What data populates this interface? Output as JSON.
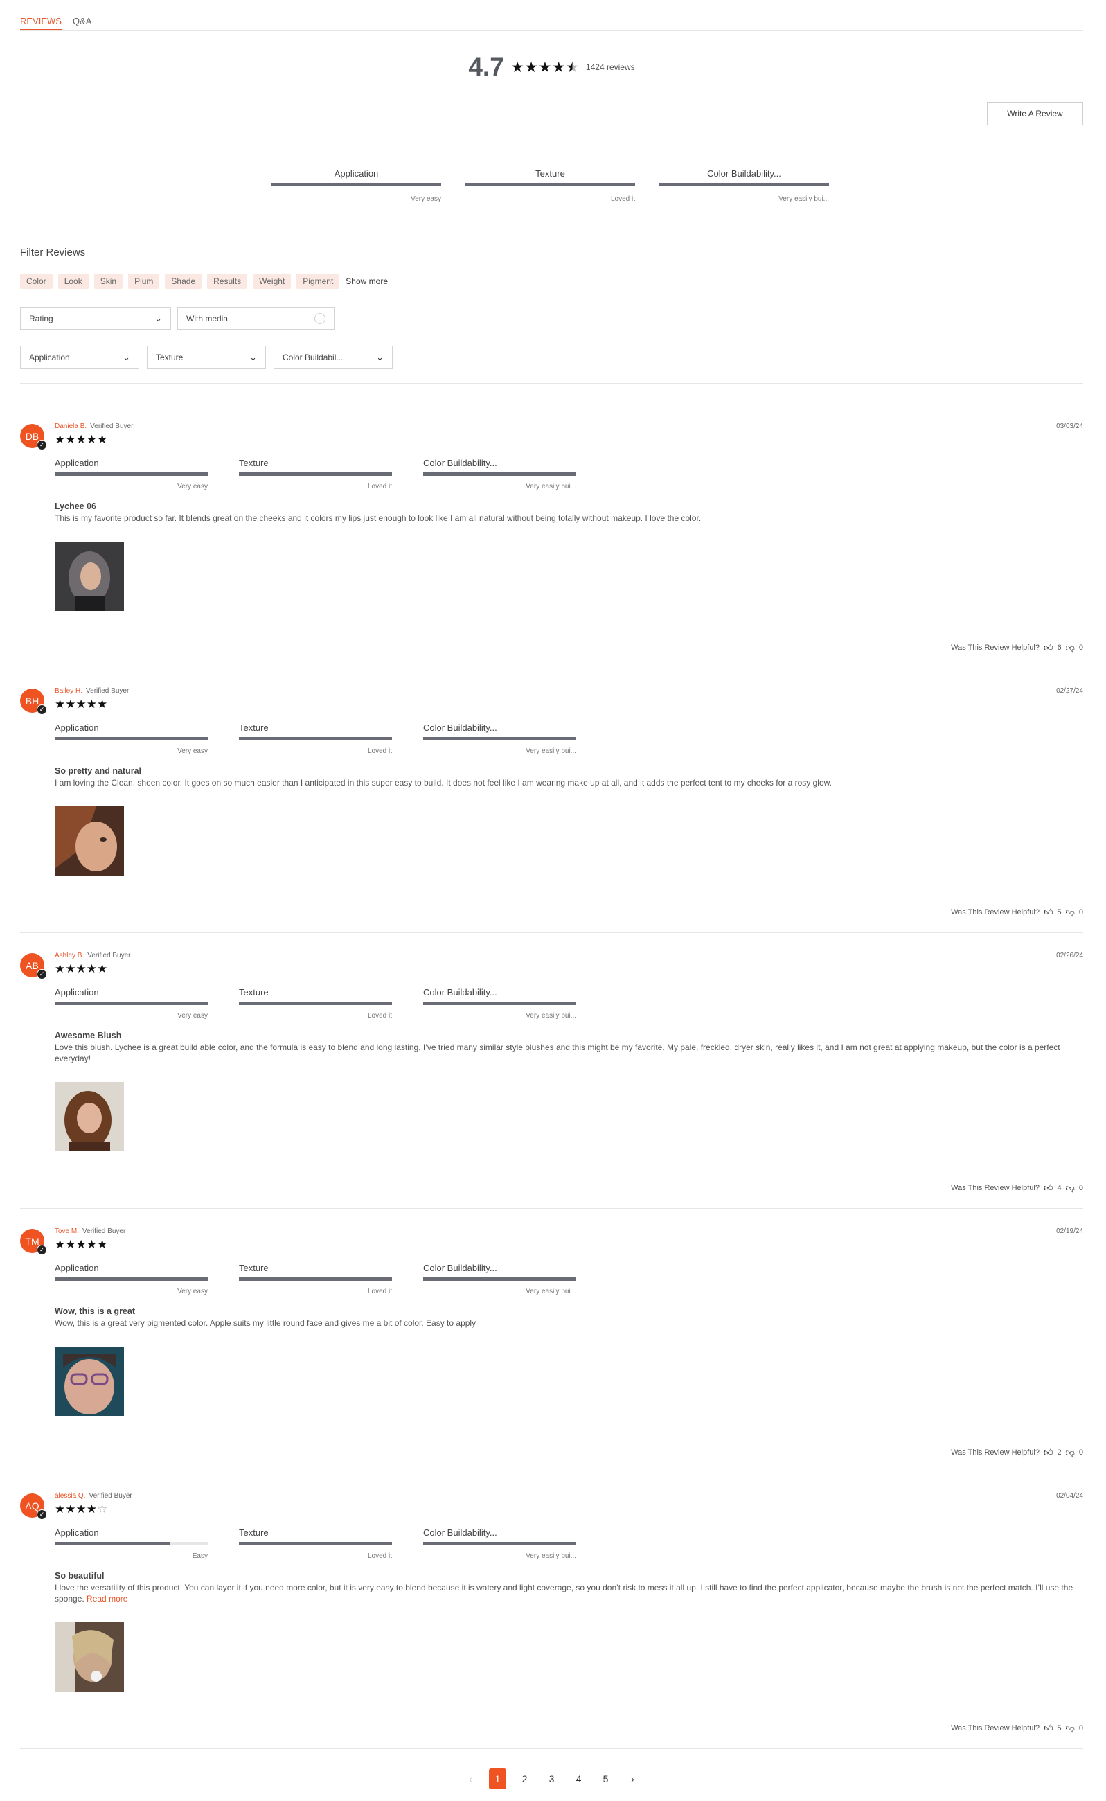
{
  "tabs": [
    {
      "label": "REVIEWS"
    },
    {
      "label": "Q&A"
    }
  ],
  "summary": {
    "rating": "4.7",
    "stars": 4.5,
    "count_text": "1424 reviews"
  },
  "write_review_label": "Write A Review",
  "attributes": [
    {
      "label": "Application",
      "value": "Very easy"
    },
    {
      "label": "Texture",
      "value": "Loved it"
    },
    {
      "label": "Color Buildability...",
      "value": "Very easily bui..."
    }
  ],
  "filters": {
    "title": "Filter Reviews",
    "chips": [
      "Color",
      "Look",
      "Skin",
      "Plum",
      "Shade",
      "Results",
      "Weight",
      "Pigment"
    ],
    "show_more": "Show more",
    "rating_select": "Rating",
    "media_toggle": "With media",
    "attr_selects": [
      "Application",
      "Texture",
      "Color Buildabil..."
    ]
  },
  "helpful_label": "Was This Review Helpful?",
  "verified_label": "Verified Buyer",
  "reviews": [
    {
      "initials": "DB",
      "name": "Daniela B.",
      "date": "03/03/24",
      "stars": 5,
      "attrs": [
        {
          "label": "Application",
          "value": "Very easy",
          "pct": 1
        },
        {
          "label": "Texture",
          "value": "Loved it",
          "pct": 1
        },
        {
          "label": "Color Buildability...",
          "value": "Very easily bui...",
          "pct": 1
        }
      ],
      "title": "Lychee 06",
      "body": "This is my favorite product so far. It blends great on the cheeks and it colors my lips just enough to look like I am all natural without being totally without makeup. I love the color.",
      "up": "6",
      "down": "0"
    },
    {
      "initials": "BH",
      "name": "Bailey H.",
      "date": "02/27/24",
      "stars": 5,
      "attrs": [
        {
          "label": "Application",
          "value": "Very easy",
          "pct": 1
        },
        {
          "label": "Texture",
          "value": "Loved it",
          "pct": 1
        },
        {
          "label": "Color Buildability...",
          "value": "Very easily bui...",
          "pct": 1
        }
      ],
      "title": "So pretty and natural",
      "body": "I am loving the Clean, sheen color. It goes on so much easier than I anticipated in this super easy to build. It does not feel like I am wearing make up at all, and it adds the perfect tent to my cheeks for a rosy glow.",
      "up": "5",
      "down": "0"
    },
    {
      "initials": "AB",
      "name": "Ashley B.",
      "date": "02/26/24",
      "stars": 5,
      "attrs": [
        {
          "label": "Application",
          "value": "Very easy",
          "pct": 1
        },
        {
          "label": "Texture",
          "value": "Loved it",
          "pct": 1
        },
        {
          "label": "Color Buildability...",
          "value": "Very easily bui...",
          "pct": 1
        }
      ],
      "title": "Awesome Blush",
      "body": "Love this blush. Lychee is a great build able color, and the formula is easy to blend and long lasting. I’ve tried many similar style blushes and this might be my favorite. My pale, freckled, dryer skin, really likes it, and I am not great at applying makeup, but the color is a perfect everyday!",
      "up": "4",
      "down": "0"
    },
    {
      "initials": "TM",
      "name": "Tove M.",
      "date": "02/19/24",
      "stars": 5,
      "attrs": [
        {
          "label": "Application",
          "value": "Very easy",
          "pct": 1
        },
        {
          "label": "Texture",
          "value": "Loved it",
          "pct": 1
        },
        {
          "label": "Color Buildability...",
          "value": "Very easily bui...",
          "pct": 1
        }
      ],
      "title": "Wow, this is a great",
      "body": "Wow, this is a great very pigmented color. Apple suits my little round face and gives me a bit of color. Easy to apply",
      "up": "2",
      "down": "0"
    },
    {
      "initials": "AQ",
      "name": "alessia Q.",
      "date": "02/04/24",
      "stars": 4,
      "attrs": [
        {
          "label": "Application",
          "value": "Easy",
          "pct": 0.75
        },
        {
          "label": "Texture",
          "value": "Loved it",
          "pct": 1
        },
        {
          "label": "Color Buildability...",
          "value": "Very easily bui...",
          "pct": 1
        }
      ],
      "title": "So beautiful",
      "body": "I love the versatility of this product. You can layer it if you need more color, but it is very easy to blend because it is watery and light coverage, so you don’t risk to mess it all up. I still have to find the perfect applicator, because maybe the brush is not the perfect match. I’ll use the sponge.",
      "read_more": "Read more",
      "up": "5",
      "down": "0"
    }
  ],
  "pagination": {
    "pages": [
      "1",
      "2",
      "3",
      "4",
      "5"
    ],
    "current": "1"
  },
  "colors": {
    "accent": "#ee5321",
    "bar": "#696c75",
    "chip_bg": "#fbe8e2"
  }
}
